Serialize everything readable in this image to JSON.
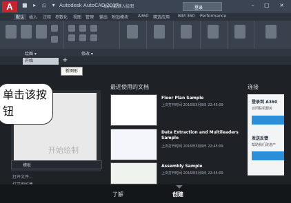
{
  "app": {
    "logo_letter": "A",
    "quick_access_icons": "■ ▸ ⎌ ▾",
    "title": "Autodesk AutoCAD 2017",
    "doc_title": "插入/或键入绘图",
    "search_hint": "登录",
    "window_buttons": "– □ ×"
  },
  "ribbon": {
    "tabs": [
      "默认",
      "插入",
      "注释",
      "参数化",
      "视图",
      "管理",
      "输出",
      "附加模块",
      "A360",
      "精选应用",
      "BIM 360",
      "Performance"
    ],
    "panels": [
      "绘图 ▾",
      "修改 ▾"
    ]
  },
  "file_tabs": {
    "start": "开始",
    "plus": "+"
  },
  "tooltip": "新图形",
  "callout": "单击该按钮",
  "start": {
    "paper_text": "开始绘制",
    "templates": "模板",
    "links": [
      "打开文件...",
      "打开图纸集..."
    ]
  },
  "recent": {
    "heading": "最近使用的文档",
    "docs": [
      {
        "title": "Floor Plan Sample",
        "meta": "上次打开时间 2016年5月9日 22:45:09"
      },
      {
        "title": "Data Extraction and Multileaders Sample",
        "meta": "上次打开时间 2016年5月9日 22:45:09"
      },
      {
        "title": "Assembly Sample",
        "meta": "上次打开时间 2016年5月9日 22:45:09"
      }
    ]
  },
  "connect": {
    "heading": "连接",
    "login_title": "登录到 A360",
    "login_sub": "访问联机服务",
    "feedback_title": "发送反馈",
    "feedback_sub": "帮助我们改进产"
  },
  "bottom_tabs": [
    "了解",
    "创建"
  ],
  "colors": {
    "accent": "#2a8fd8",
    "logo": "#c2262e"
  }
}
